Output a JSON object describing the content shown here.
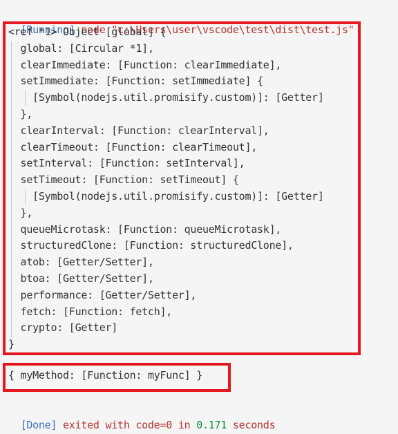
{
  "run_header": {
    "tag": "[Running]",
    "command": "node \"c:\\Users\\user\\vscode\\test\\dist\\test.js\""
  },
  "global_object_lines": [
    "<ref *1> Object [global] {",
    "  global: [Circular *1],",
    "  clearImmediate: [Function: clearImmediate],",
    "  setImmediate: [Function: setImmediate] {",
    "    [Symbol(nodejs.util.promisify.custom)]: [Getter]",
    "  },",
    "  clearInterval: [Function: clearInterval],",
    "  clearTimeout: [Function: clearTimeout],",
    "  setInterval: [Function: setInterval],",
    "  setTimeout: [Function: setTimeout] {",
    "    [Symbol(nodejs.util.promisify.custom)]: [Getter]",
    "  },",
    "  queueMicrotask: [Function: queueMicrotask],",
    "  structuredClone: [Function: structuredClone],",
    "  atob: [Getter/Setter],",
    "  btoa: [Getter/Setter],",
    "  performance: [Getter/Setter],",
    "  fetch: [Function: fetch],",
    "  crypto: [Getter]",
    "}"
  ],
  "my_object_line": "{ myMethod: [Function: myFunc] }",
  "done_footer": {
    "tag": "[Done]",
    "text_before": "exited with code=0 in",
    "seconds": "0.171",
    "text_after": "seconds"
  },
  "colors": {
    "background": "#f5f5f5",
    "text": "#333333",
    "tag_blue": "#3b6fbf",
    "command_red": "#b5322d",
    "number_green": "#0e8a3c",
    "highlight_box_red": "#e3191f"
  }
}
